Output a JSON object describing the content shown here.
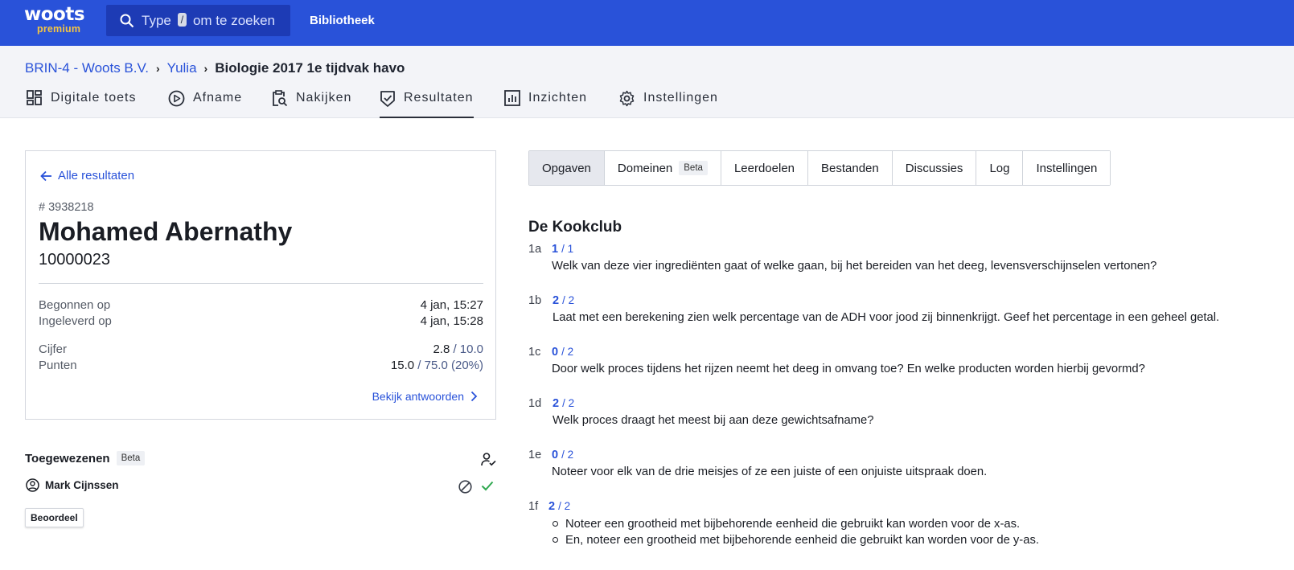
{
  "app": {
    "logo_main": "woots",
    "logo_sub": "premium",
    "search_prefix": "Type",
    "search_key": "/",
    "search_suffix": "om te zoeken",
    "library": "Bibliotheek"
  },
  "breadcrumb": {
    "items": [
      "BRIN-4 - Woots B.V.",
      "Yulia"
    ],
    "current": "Biologie 2017 1e tijdvak havo"
  },
  "nav": {
    "tabs": [
      {
        "label": "Digitale toets",
        "icon": "dashboard-icon"
      },
      {
        "label": "Afname",
        "icon": "play-circle-icon"
      },
      {
        "label": "Nakijken",
        "icon": "clipboard-search-icon"
      },
      {
        "label": "Resultaten",
        "icon": "shield-check-icon",
        "active": true
      },
      {
        "label": "Inzichten",
        "icon": "bar-chart-icon"
      },
      {
        "label": "Instellingen",
        "icon": "gear-icon"
      }
    ]
  },
  "result": {
    "back_label": "Alle resultaten",
    "number": "# 3938218",
    "student_name": "Mohamed Abernathy",
    "student_id": "10000023",
    "started_label": "Begonnen op",
    "started_value": "4 jan, 15:27",
    "submitted_label": "Ingeleverd op",
    "submitted_value": "4 jan, 15:28",
    "grade_label": "Cijfer",
    "grade_value": "2.8",
    "grade_max": "/ 10.0",
    "points_label": "Punten",
    "points_value": "15.0",
    "points_max": "/ 75.0 (20%)",
    "view_answers": "Bekijk antwoorden"
  },
  "assigned": {
    "title": "Toegewezenen",
    "badge": "Beta",
    "assignee": "Mark Cijnssen",
    "grade_button": "Beoordeel"
  },
  "tabs": {
    "items": [
      "Opgaven",
      "Domeinen",
      "Leerdoelen",
      "Bestanden",
      "Discussies",
      "Log",
      "Instellingen"
    ],
    "domain_badge": "Beta",
    "active": "Opgaven"
  },
  "questions": {
    "section_title": "De Kookclub",
    "items": [
      {
        "id": "1a",
        "score": "1",
        "max": "/ 1",
        "text": "Welk van deze vier ingrediënten gaat of welke gaan, bij het bereiden van het deeg, levensverschijnselen vertonen?"
      },
      {
        "id": "1b",
        "score": "2",
        "max": "/ 2",
        "text": "Laat met een berekening zien welk percentage van de ADH voor jood zij binnenkrijgt. Geef het percentage in een geheel getal."
      },
      {
        "id": "1c",
        "score": "0",
        "max": "/ 2",
        "text": "Door welk proces tijdens het rijzen neemt het deeg in omvang toe? En welke producten worden hierbij gevormd?"
      },
      {
        "id": "1d",
        "score": "2",
        "max": "/ 2",
        "text": "Welk proces draagt het meest bij aan deze gewichtsafname?"
      },
      {
        "id": "1e",
        "score": "0",
        "max": "/ 2",
        "text": "Noteer voor elk van de drie meisjes of ze een juiste of een onjuiste uitspraak doen."
      },
      {
        "id": "1f",
        "score": "2",
        "max": "/ 2",
        "bullets": [
          "Noteer een grootheid met bijbehorende eenheid die gebruikt kan worden voor de x-as.",
          "En, noteer een grootheid met bijbehorende eenheid die gebruikt kan worden voor de y-as."
        ]
      }
    ]
  }
}
